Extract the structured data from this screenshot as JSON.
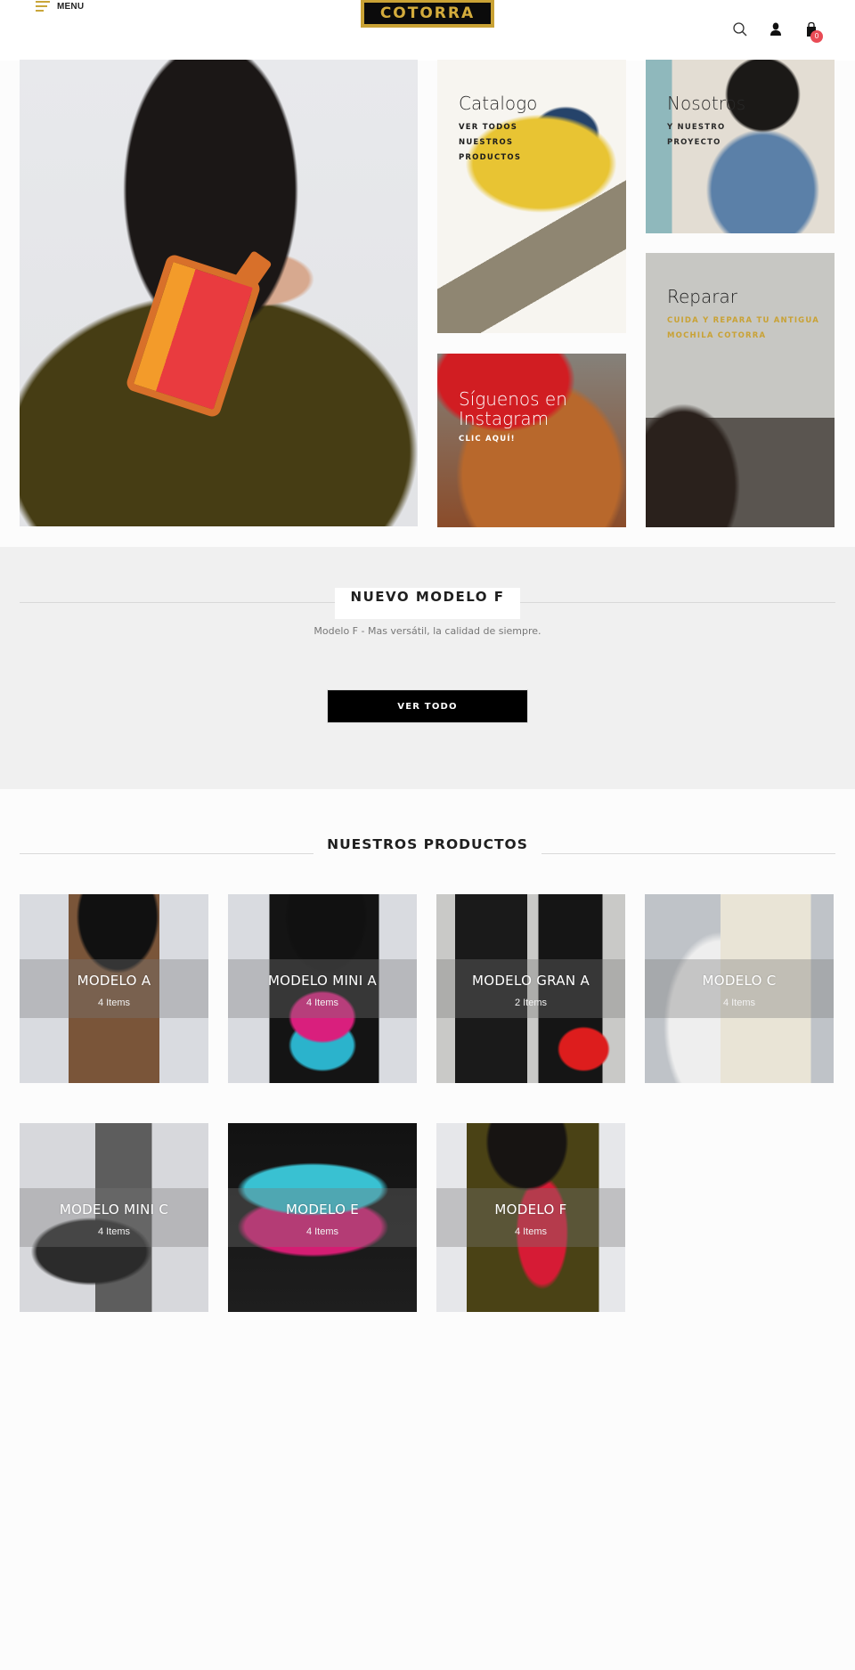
{
  "header": {
    "menu_label": "MENU",
    "logo_text": "COTORRA",
    "icons": [
      "search-icon",
      "user-icon",
      "cart-icon"
    ],
    "cart_count": "0",
    "colors": {
      "logo_gold": "#c9a235",
      "badge": "#e94b55",
      "menu_accent": "#c9a63a"
    }
  },
  "hero": {
    "main_image_alt": "Mujer con bolso Modelo F",
    "tiles": [
      {
        "title": "Catalogo",
        "subtitle": "VER TODOS NUESTROS PRODUCTOS"
      },
      {
        "title": "Nosotros",
        "subtitle": "Y NUESTRO PROYECTO"
      },
      {
        "title": "Síguenos en Instagram",
        "subtitle": "CLIC AQUÍ!"
      },
      {
        "title": "Reparar",
        "subtitle": "CUIDA Y REPARA TU ANTIGUA MOCHILA COTORRA"
      }
    ],
    "subtitle_gold": "#c9a235"
  },
  "nuevo_modelo": {
    "title": "NUEVO MODELO F",
    "subtitle": "Modelo F - Mas versátil, la calidad de siempre.",
    "button_label": "VER TODO"
  },
  "productos": {
    "title": "NUESTROS PRODUCTOS",
    "items": [
      {
        "name": "MODELO A",
        "count": "4 Items"
      },
      {
        "name": "MODELO MINI A",
        "count": "4 Items"
      },
      {
        "name": "MODELO GRAN A",
        "count": "2 Items"
      },
      {
        "name": "MODELO C",
        "count": "4 Items"
      },
      {
        "name": "MODELO MINI C",
        "count": "4 Items"
      },
      {
        "name": "MODELO E",
        "count": "4 Items"
      },
      {
        "name": "MODELO F",
        "count": "4 Items"
      }
    ]
  }
}
